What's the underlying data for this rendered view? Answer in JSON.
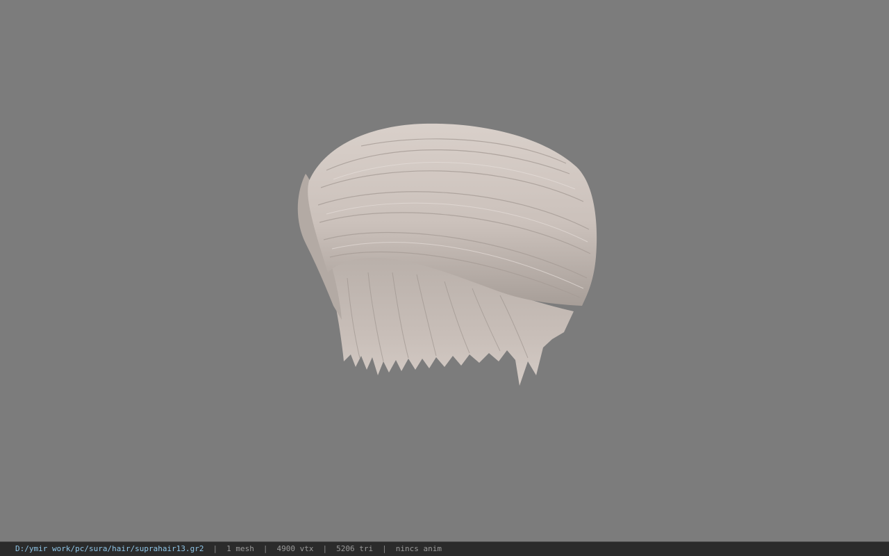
{
  "viewport": {
    "background_color": "#7c7c7c",
    "model": {
      "name": "hair-mesh",
      "base_color": "#cdc3bd",
      "shadow_color": "#8d8580"
    }
  },
  "status_bar": {
    "file_path": "D:/ymir work/pc/sura/hair/suprahair13.gr2",
    "separator": "|",
    "mesh_count": "1 mesh",
    "vertex_count": "4900 vtx",
    "triangle_count": "5206 tri",
    "anim_status": "nincs anim",
    "path_color": "#8fc6e8",
    "text_color": "#9a9a9a"
  }
}
